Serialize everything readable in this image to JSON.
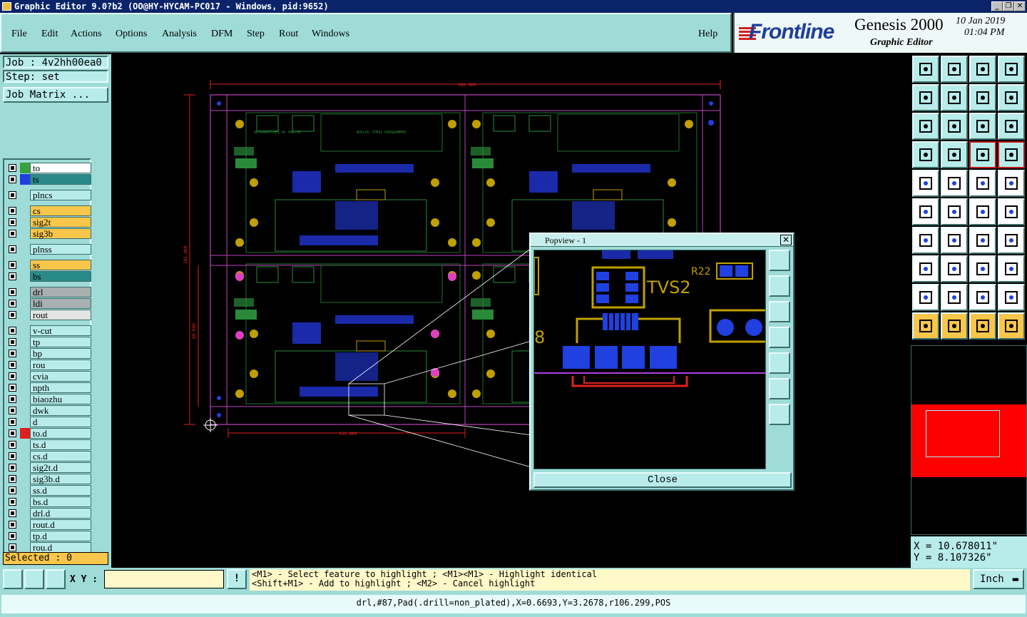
{
  "window": {
    "title": "Graphic Editor 9.0?b2 (OO@HY-HYCAM-PC017 - Windows, pid:9652)",
    "min_btn": "_",
    "max_btn": "❐",
    "close_btn": "✕"
  },
  "menu": {
    "items": [
      "File",
      "Edit",
      "Actions",
      "Options",
      "Analysis",
      "DFM",
      "Step",
      "Rout",
      "Windows"
    ],
    "help": "Help"
  },
  "logo": {
    "brand": "Frontline",
    "product": "Genesis 2000",
    "subtitle": "Graphic Editor",
    "date": "10 Jan 2019",
    "time": "01:04 PM"
  },
  "job": {
    "job_label": "Job : 4v2hh00ea0",
    "step_label": "Step: set",
    "matrix_button": "Job Matrix ..."
  },
  "layers": [
    {
      "name": "to",
      "swatch": "#3aa040",
      "bg": "#ffffff"
    },
    {
      "name": "ts",
      "swatch": "#1f3fe0",
      "bg": "#2a8a88"
    },
    {
      "name": "plncs",
      "swatch": "",
      "bg": "#b8ecea"
    },
    {
      "name": "cs",
      "swatch": "",
      "bg": "#f8c64a"
    },
    {
      "name": "sig2t",
      "swatch": "",
      "bg": "#f8c64a"
    },
    {
      "name": "sig3b",
      "swatch": "",
      "bg": "#f8c64a"
    },
    {
      "name": "plnss",
      "swatch": "",
      "bg": "#b8ecea"
    },
    {
      "name": "ss",
      "swatch": "",
      "bg": "#f8c64a"
    },
    {
      "name": "bs",
      "swatch": "",
      "bg": "#2a8a88"
    },
    {
      "name": "drl",
      "swatch": "",
      "bg": "#a8b0b0"
    },
    {
      "name": "ldi",
      "swatch": "",
      "bg": "#a8b0b0"
    },
    {
      "name": "rout",
      "swatch": "",
      "bg": "#e4e4e4"
    },
    {
      "name": "v-cut",
      "swatch": "",
      "bg": "#b8ecea"
    },
    {
      "name": "tp",
      "swatch": "",
      "bg": "#b8ecea"
    },
    {
      "name": "bp",
      "swatch": "",
      "bg": "#b8ecea"
    },
    {
      "name": "rou",
      "swatch": "",
      "bg": "#b8ecea"
    },
    {
      "name": "cvia",
      "swatch": "",
      "bg": "#b8ecea"
    },
    {
      "name": "npth",
      "swatch": "",
      "bg": "#b8ecea"
    },
    {
      "name": "biaozhu",
      "swatch": "",
      "bg": "#b8ecea"
    },
    {
      "name": "dwk",
      "swatch": "",
      "bg": "#b8ecea"
    },
    {
      "name": "d",
      "swatch": "",
      "bg": "#b8ecea"
    },
    {
      "name": "to.d",
      "swatch": "#e02020",
      "bg": "#b8ecea"
    },
    {
      "name": "ts.d",
      "swatch": "",
      "bg": "#b8ecea"
    },
    {
      "name": "cs.d",
      "swatch": "",
      "bg": "#b8ecea"
    },
    {
      "name": "sig2t.d",
      "swatch": "",
      "bg": "#b8ecea"
    },
    {
      "name": "sig3b.d",
      "swatch": "",
      "bg": "#b8ecea"
    },
    {
      "name": "ss.d",
      "swatch": "",
      "bg": "#b8ecea"
    },
    {
      "name": "bs.d",
      "swatch": "",
      "bg": "#b8ecea"
    },
    {
      "name": "drl.d",
      "swatch": "",
      "bg": "#b8ecea"
    },
    {
      "name": "rout.d",
      "swatch": "",
      "bg": "#b8ecea"
    },
    {
      "name": "tp.d",
      "swatch": "",
      "bg": "#b8ecea"
    },
    {
      "name": "rou.d",
      "swatch": "",
      "bg": "#b8ecea"
    }
  ],
  "selected_label": "Selected : 0",
  "canvas": {
    "dim_top": "286.000",
    "dim_bottom": "152.000",
    "dim_left": "185.000",
    "dim_mid": "80.000",
    "board_title": "NUCLEO STM32 PROGRAMMER",
    "switch_label": "OUT&SWITCHES AC-PWR/PK",
    "tvs_label": "TVS2",
    "r22_label": "R22"
  },
  "popview": {
    "title": "Popview - 1",
    "close_label": "Close",
    "x_btn": "✕"
  },
  "coords": {
    "x": "X = 10.678011\"",
    "y": "Y = 8.107326\""
  },
  "bottom": {
    "xy_label": "X Y :",
    "xy_value": "",
    "hint_line1": "<M1> - Select feature to highlight ; <M1><M1> - Highlight identical",
    "hint_line2": "<Shift+M1> - Add to highlight ; <M2> - Cancel highlight",
    "unit": "Inch",
    "warn": "!"
  },
  "status": "drl,#87,Pad(.drill=non_plated),X=0.6693,Y=3.2678,r106.299,POS"
}
